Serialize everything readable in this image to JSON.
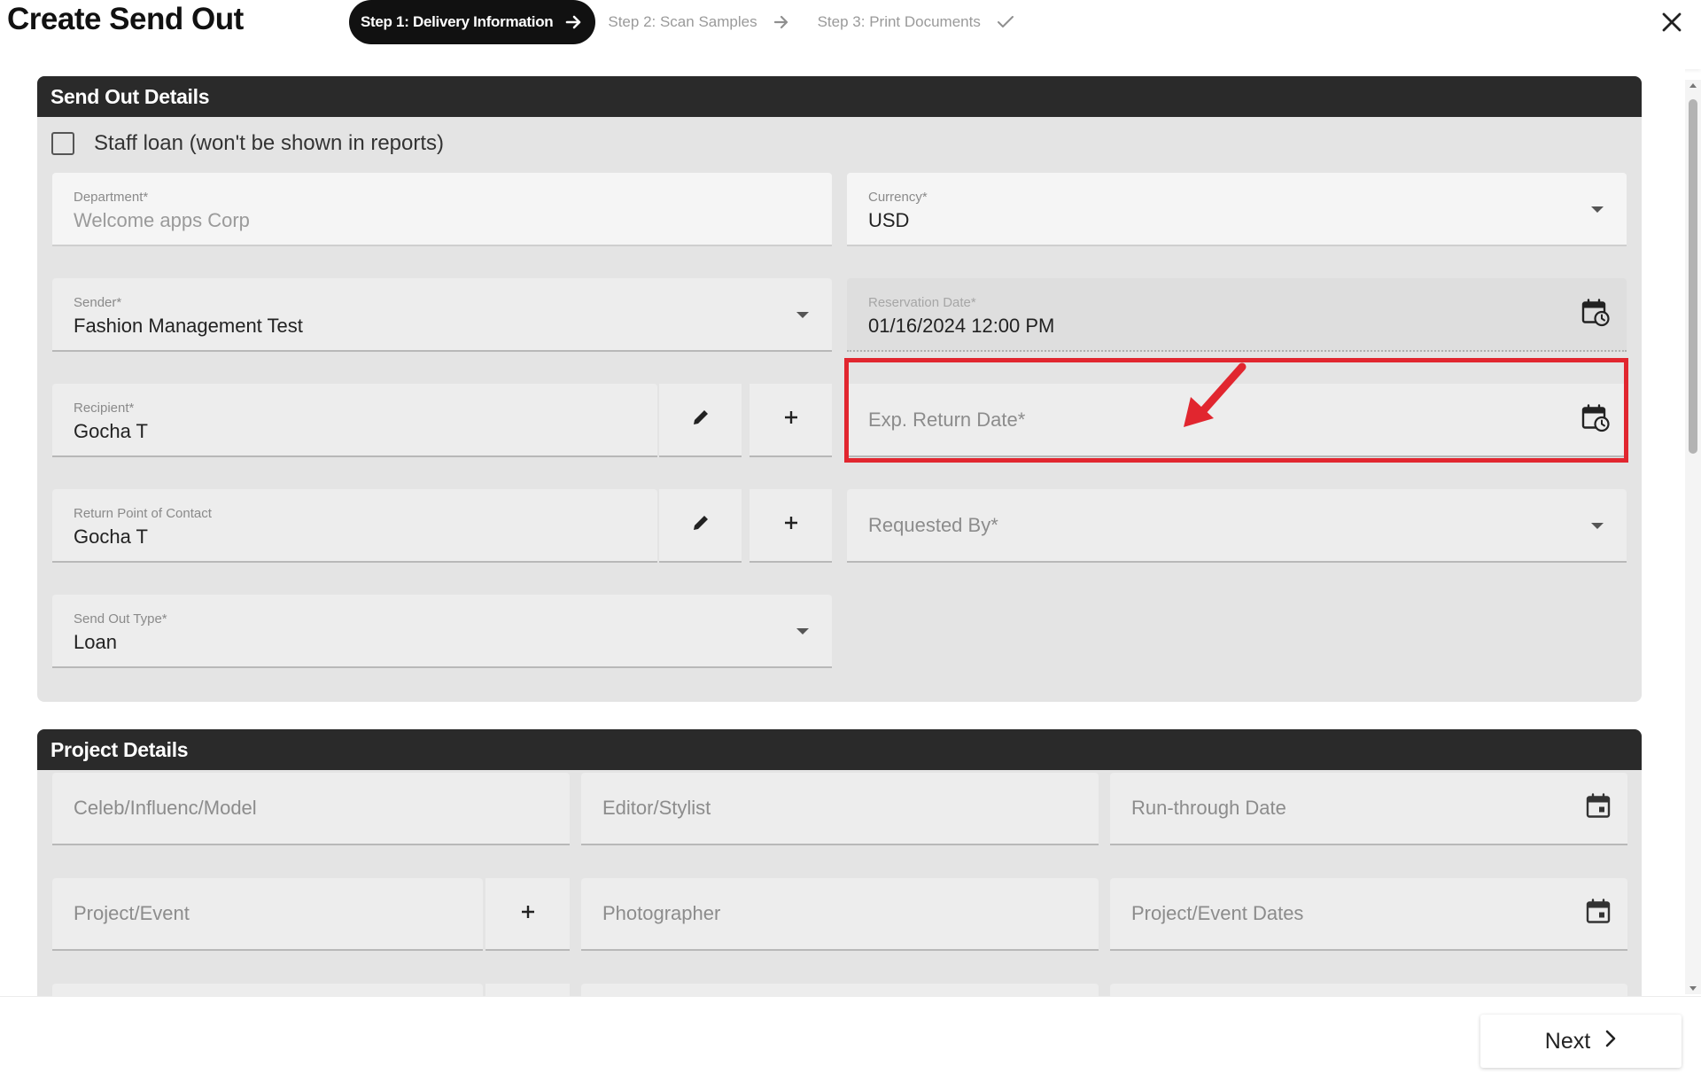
{
  "header": {
    "title": "Create Send Out",
    "steps": [
      {
        "label": "Step 1: Delivery Information",
        "state": "active",
        "icon": "arrow-right-icon"
      },
      {
        "label": "Step 2: Scan Samples",
        "state": "pending",
        "icon": "arrow-right-icon"
      },
      {
        "label": "Step 3: Print Documents",
        "state": "pending",
        "icon": "check-icon"
      }
    ],
    "close_icon": "close-icon"
  },
  "send_out_details": {
    "title": "Send Out Details",
    "staff_loan": {
      "label": "Staff loan (won't be shown in reports)",
      "checked": false
    },
    "department": {
      "label": "Department*",
      "value": "Welcome apps Corp"
    },
    "currency": {
      "label": "Currency*",
      "value": "USD"
    },
    "sender": {
      "label": "Sender*",
      "value": "Fashion Management Test"
    },
    "reservation_date": {
      "label": "Reservation Date*",
      "value": "01/16/2024 12:00 PM"
    },
    "recipient": {
      "label": "Recipient*",
      "value": "Gocha T"
    },
    "exp_return_date": {
      "placeholder": "Exp. Return Date*"
    },
    "return_point_of_contact": {
      "label": "Return Point of Contact",
      "value": "Gocha T"
    },
    "requested_by": {
      "placeholder": "Requested By*"
    },
    "send_out_type": {
      "label": "Send Out Type*",
      "value": "Loan"
    }
  },
  "project_details": {
    "title": "Project Details",
    "celeb": {
      "placeholder": "Celeb/Influenc/Model"
    },
    "editor": {
      "placeholder": "Editor/Stylist"
    },
    "run_through_date": {
      "placeholder": "Run-through Date"
    },
    "project_event": {
      "placeholder": "Project/Event"
    },
    "photographer": {
      "placeholder": "Photographer"
    },
    "project_event_dates": {
      "placeholder": "Project/Event Dates"
    }
  },
  "footer": {
    "next_label": "Next"
  },
  "colors": {
    "highlight": "#e1262f",
    "panel_header": "#2a2a2a",
    "panel_body": "#e4e4e4"
  }
}
